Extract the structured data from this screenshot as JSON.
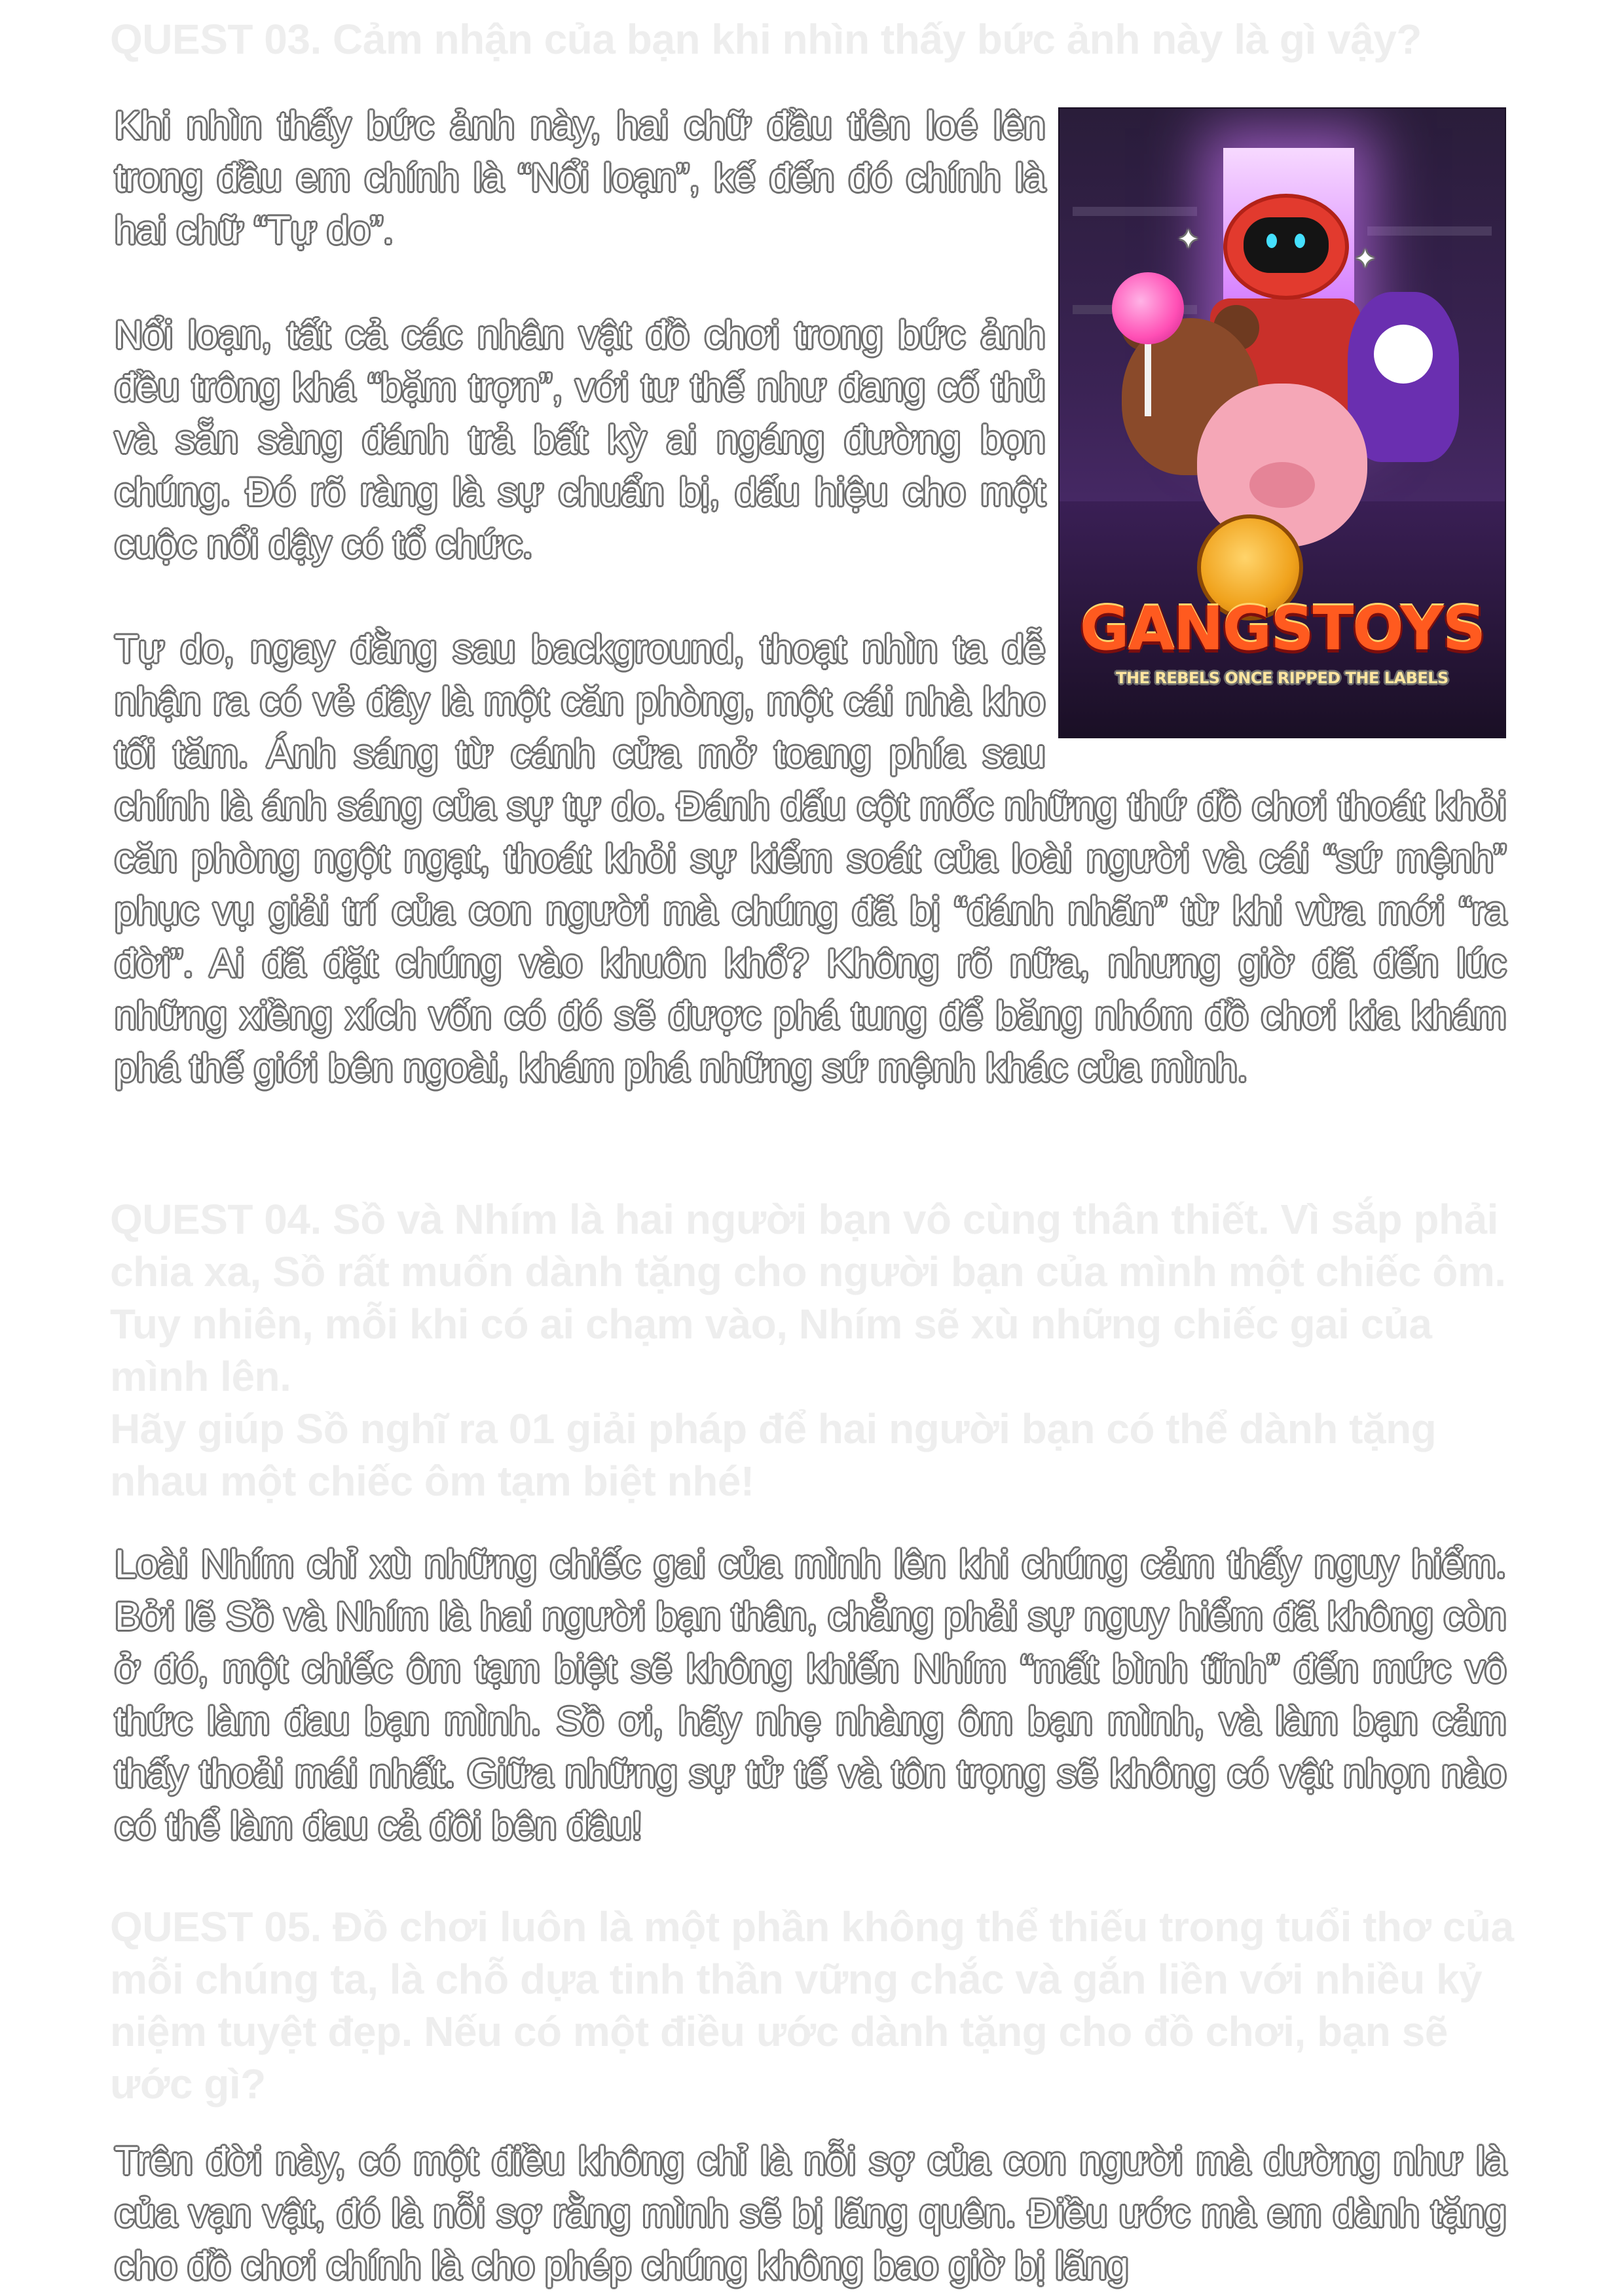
{
  "quest03": {
    "heading": "QUEST 03. Cảm nhận của bạn khi nhìn thấy bức ảnh này là gì vậy?",
    "paragraphs": [
      "Khi nhìn thấy bức ảnh này, hai chữ đầu tiên loé lên trong đầu em chính là “Nổi loạn”, kế đến đó chính là hai chữ “Tự do”.",
      "Nổi loạn, tất cả các nhân vật đồ chơi trong bức ảnh đều trông khá “bặm trợn”, với tư thế như đang cố thủ và sẵn sàng đánh trả bất kỳ ai ngáng đường bọn chúng. Đó rõ ràng là sự chuẩn bị, dấu hiệu cho một cuộc nổi dậy có tổ chức.",
      "Tự do, ngay đằng sau background, thoạt nhìn ta dễ nhận ra có vẻ đây là một căn phòng, một cái nhà kho tối tăm. Ánh sáng từ cánh cửa mở toang phía sau chính là ánh sáng của sự tự do. Đánh dấu cột mốc những thứ đồ chơi thoát khỏi căn phòng ngột ngạt, thoát khỏi sự kiểm soát của loài người và cái “sứ mệnh” phục vụ giải trí của con người mà chúng đã bị “đánh nhãn” từ khi vừa mới “ra đời”. Ai đã đặt chúng vào khuôn khổ? Không rõ nữa, nhưng giờ đã đến lúc những xiềng xích vốn có đó sẽ được phá tung để băng nhóm đồ chơi kia khám phá thế giới bên ngoài, khám phá những sứ mệnh khác của mình."
    ],
    "poster": {
      "title": "GANGSTOYS",
      "tagline": "THE REBELS ONCE RIPPED THE LABELS"
    }
  },
  "quest04": {
    "heading_lines": [
      "QUEST 04. Sồ và Nhím là hai người bạn vô cùng thân thiết. Vì sắp phải chia xa, Sồ rất muốn dành tặng cho người bạn của mình một chiếc ôm. Tuy nhiên, mỗi khi có ai chạm vào, Nhím sẽ xù những chiếc gai của mình lên.",
      "Hãy giúp Sồ nghĩ ra 01 giải pháp để hai người bạn có thể dành tặng nhau một chiếc ôm tạm biệt nhé!"
    ],
    "answer": "Loài Nhím chỉ xù những chiếc gai của mình lên khi chúng cảm thấy nguy hiểm. Bởi lẽ Sồ và Nhím là hai người bạn thân, chẳng phải sự nguy hiểm đã không còn ở đó, một chiếc ôm tạm biệt sẽ không khiến Nhím “mất bình tĩnh” đến mức vô thức làm đau bạn mình. Sồ ơi, hãy nhẹ nhàng ôm bạn mình, và làm bạn cảm thấy thoải mái nhất. Giữa những sự tử tế và tôn trọng sẽ không có vật nhọn nào có thể làm đau cả đôi bên đâu!"
  },
  "quest05": {
    "heading": "QUEST 05. Đồ chơi luôn là một phần không thể thiếu trong tuổi thơ của mỗi chúng ta, là chỗ dựa tinh thần vững chắc và gắn liền với nhiều kỷ niệm tuyệt đẹp. Nếu có một điều ước dành tặng cho đồ chơi, bạn sẽ ước gì?",
    "answer": "Trên đời này, có một điều không chỉ là nỗi sợ của con người mà dường như là của vạn vật, đó là nỗi sợ rằng mình sẽ bị lãng quên. Điều ước mà em dành tặng cho đồ chơi chính là cho phép chúng không bao giờ bị lãng"
  },
  "colors": {
    "heading": "#eeeeee",
    "text_fill": "#ffffff",
    "text_outline": "#6e6e6e",
    "poster_title": "#ff5a1f"
  }
}
